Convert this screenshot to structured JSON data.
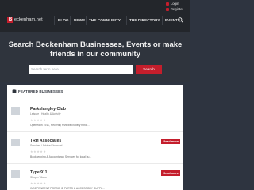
{
  "colors": {
    "brand_red": "#c41e2c",
    "nav_bg": "#23262b",
    "hero_bg": "#2f343d"
  },
  "header": {
    "logo_mark": "B",
    "logo_text": "eckenham.net",
    "nav": [
      "BLOG",
      "NEWS",
      "THE COMMUNITY",
      "THE DIRECTORY",
      "EVENTS"
    ],
    "login_label": "Login",
    "register_label": "Register",
    "search_icon": "search-icon"
  },
  "hero": {
    "title": "Search Beckenham Businesses, Events or make friends in our community",
    "search_placeholder": "Search term here...",
    "search_button": "Search"
  },
  "featured": {
    "title": "FEATURED BUSINESSES",
    "read_more_label": "Read more",
    "items": [
      {
        "name": "Parkslangley Club",
        "category": "Leisure / Health & Activity",
        "description": "Opened in 1911, Recently reviewed tollery fundr...",
        "rating": 0
      },
      {
        "name": "TRH Associates",
        "category": "Services / Advice/Financial",
        "description": "Bookkeeping & Accountancy Services for local bu...",
        "rating": 0
      },
      {
        "name": "Type 911",
        "category": "Shops / Motor",
        "description": "INDEPENDENT PORSCHE PARTS & ACCESSORY SUPPL...",
        "rating": 0
      }
    ]
  }
}
